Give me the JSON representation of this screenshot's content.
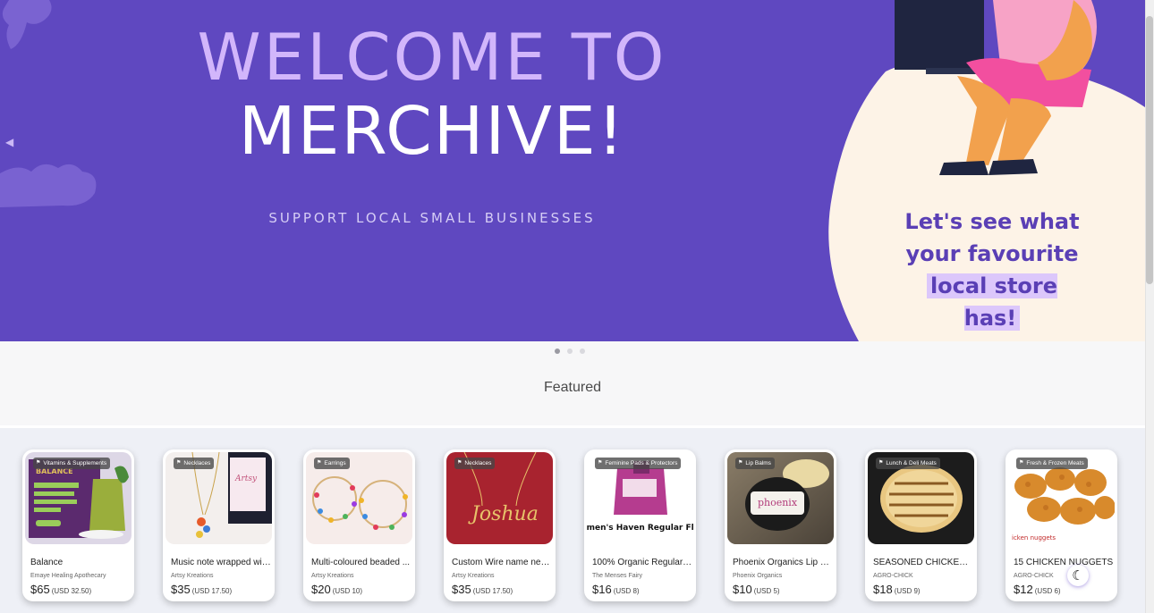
{
  "hero": {
    "title_line1": "WELCOME TO",
    "title_line2": "MERCHIVE!",
    "subtitle": "SUPPORT LOCAL SMALL BUSINESSES",
    "tagline_line1": "Let's see what",
    "tagline_line2": "your favourite",
    "tagline_line3": "local store has!",
    "prev_icon": "chevron-left-icon",
    "next_icon": "chevron-right-icon",
    "colors": {
      "background": "#5f48c0",
      "title_accent": "#d2b6fb",
      "tagline": "#5a3fb5"
    }
  },
  "carousel": {
    "slide_count": 3,
    "active_index": 0
  },
  "featured": {
    "title": "Featured",
    "products": [
      {
        "category": "Vitamins & Supplements",
        "name": "Balance",
        "store": "Emaye Healing Apothecary",
        "price": "$65",
        "usd": "(USD 32.50)",
        "image_icon": "supplement-package-image"
      },
      {
        "category": "Necklaces",
        "name": "Music note wrapped wit...",
        "store": "Artsy Kreations",
        "price": "$35",
        "usd": "(USD 17.50)",
        "image_icon": "music-note-necklace-image"
      },
      {
        "category": "Earrings",
        "name": "Multi-coloured beaded ...",
        "store": "Artsy Kreations",
        "price": "$20",
        "usd": "(USD 10)",
        "image_icon": "beaded-hoop-earrings-image"
      },
      {
        "category": "Necklaces",
        "name": "Custom Wire name nec...",
        "store": "Artsy Kreations",
        "price": "$35",
        "usd": "(USD 17.50)",
        "image_icon": "wire-name-necklace-image"
      },
      {
        "category": "Feminine Pads & Protectors",
        "name": "100% Organic Regular S...",
        "store": "The Menses Fairy",
        "price": "$16",
        "usd": "(USD 8)",
        "image_icon": "pads-box-image",
        "image_text": "Women's Haven Regular Flow"
      },
      {
        "category": "Lip Balms",
        "name": "Phoenix Organics Lip Ba...",
        "store": "Phoenix Organics",
        "price": "$10",
        "usd": "(USD 5)",
        "image_icon": "lip-balm-jar-image",
        "image_text": "phoenix"
      },
      {
        "category": "Lunch & Deli Meats",
        "name": "SEASONED CHICKEN ...",
        "store": "AGRO-CHICK",
        "price": "$18",
        "usd": "(USD 9)",
        "image_icon": "chicken-patty-image"
      },
      {
        "category": "Fresh & Frozen Meats",
        "name": "15 CHICKEN NUGGETS",
        "store": "AGRO-CHICK",
        "price": "$12",
        "usd": "(USD 6)",
        "image_icon": "chicken-nuggets-image",
        "image_text": "icken nuggets"
      }
    ]
  },
  "theme_toggle": {
    "icon": "moon-icon"
  }
}
